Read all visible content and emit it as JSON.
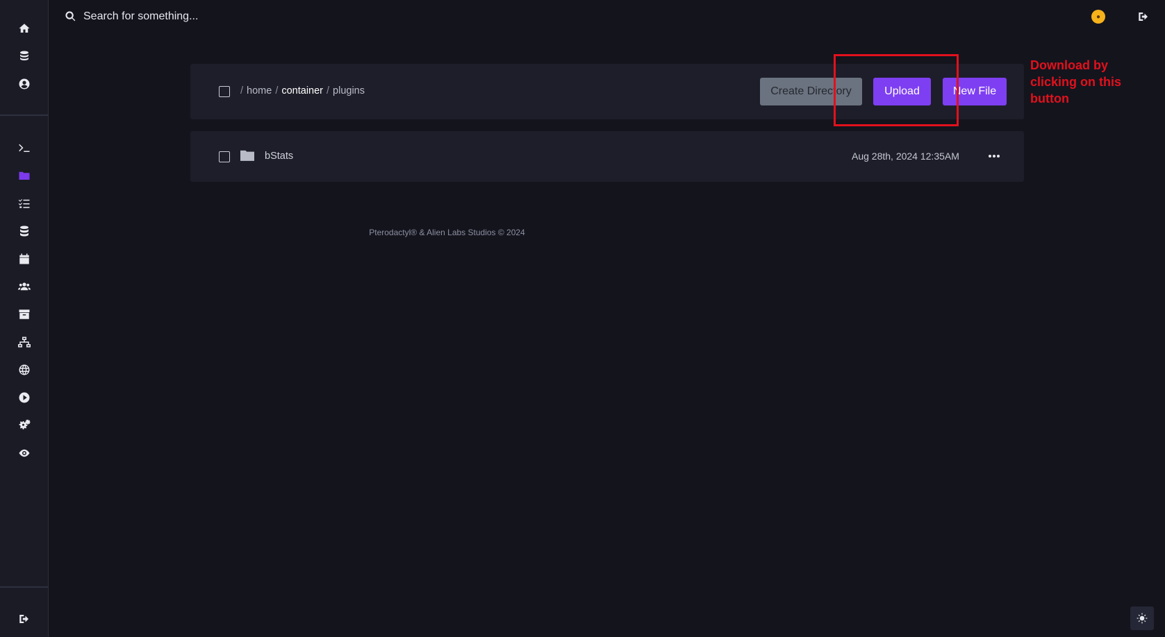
{
  "sidebar": {
    "top_items": [
      {
        "name": "home-icon"
      },
      {
        "name": "servers-icon"
      },
      {
        "name": "account-icon"
      }
    ],
    "server_items": [
      {
        "name": "console-icon"
      },
      {
        "name": "files-icon",
        "active": true
      },
      {
        "name": "tasks-icon"
      },
      {
        "name": "databases-icon"
      },
      {
        "name": "schedules-icon"
      },
      {
        "name": "users-icon"
      },
      {
        "name": "backups-icon"
      },
      {
        "name": "network-icon"
      },
      {
        "name": "globe-icon"
      },
      {
        "name": "startup-icon"
      },
      {
        "name": "settings-icon"
      },
      {
        "name": "activity-icon"
      }
    ],
    "bottom_item": {
      "name": "logout-icon"
    }
  },
  "search": {
    "placeholder": "Search for something..."
  },
  "breadcrumb": {
    "sep": "/",
    "home": "home",
    "container": "container",
    "current": "plugins"
  },
  "actions": {
    "create_directory": "Create Directory",
    "upload": "Upload",
    "new_file": "New File"
  },
  "files": [
    {
      "name": "bStats",
      "type": "folder",
      "modified": "Aug 28th, 2024 12:35AM"
    }
  ],
  "footer": {
    "text": "Pterodactyl® & Alien Labs Studios © 2024"
  },
  "annotation": {
    "text": "Download by clicking on this button"
  },
  "colors": {
    "accent": "#7e3ff2",
    "annotation": "#e1111c",
    "background": "#14141d",
    "panel": "#1e1e2a"
  }
}
